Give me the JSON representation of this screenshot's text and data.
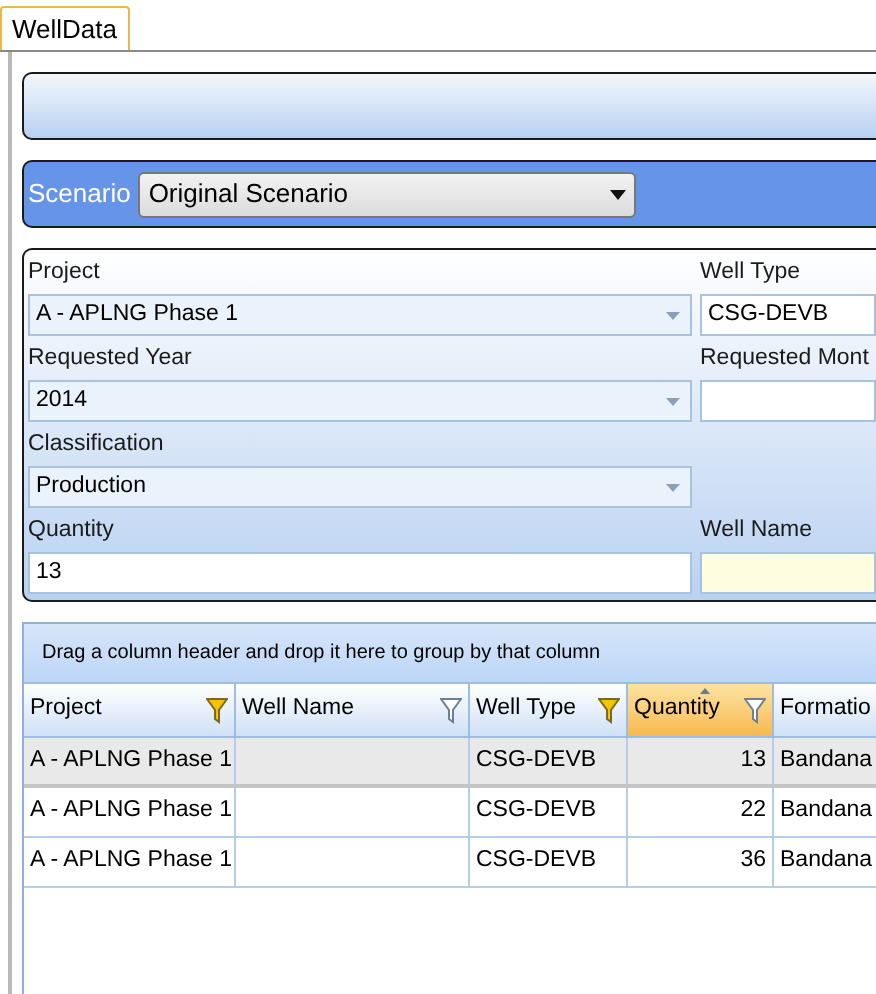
{
  "tabs": [
    {
      "label": "WellData",
      "selected": true
    }
  ],
  "scenario": {
    "label": "Scenario",
    "value": "Original Scenario"
  },
  "form": {
    "rows": [
      [
        {
          "label": "Project",
          "kind": "combo",
          "value": "A - APLNG Phase 1"
        },
        {
          "label": "Well Type",
          "kind": "text",
          "value": "CSG-DEVB"
        }
      ],
      [
        {
          "label": "Requested Year",
          "kind": "combo",
          "value": "2014"
        },
        {
          "label": "Requested Mont",
          "kind": "text"
        }
      ],
      [
        {
          "label": "Classification",
          "kind": "combo",
          "value": "Production"
        }
      ],
      [
        {
          "label": "Quantity",
          "kind": "text",
          "value": "13"
        },
        {
          "label": "Well Name",
          "kind": "text",
          "required": true
        }
      ]
    ]
  },
  "grid": {
    "group_hint": "Drag a column header and drop it here to group by that column",
    "columns": [
      {
        "label": "Project",
        "kind": "text",
        "filter_active": true,
        "selected": false,
        "sorted": false
      },
      {
        "label": "Well Name",
        "kind": "text",
        "filter_active": false,
        "selected": false,
        "sorted": false
      },
      {
        "label": "Well Type",
        "kind": "text",
        "filter_active": true,
        "selected": false,
        "sorted": false
      },
      {
        "label": "Quantity",
        "kind": "number",
        "filter_active": false,
        "selected": true,
        "sorted": true
      },
      {
        "label": "Formatio",
        "kind": "text"
      }
    ],
    "rows": [
      {
        "selected": true,
        "cells": [
          "A - APLNG Phase 1",
          "",
          "CSG-DEVB",
          "13",
          "Bandana"
        ]
      },
      {
        "selected": false,
        "cells": [
          "A - APLNG Phase 1",
          "",
          "CSG-DEVB",
          "22",
          "Bandana"
        ]
      },
      {
        "selected": false,
        "cells": [
          "A - APLNG Phase 1",
          "",
          "CSG-DEVB",
          "36",
          "Bandana"
        ]
      }
    ]
  }
}
